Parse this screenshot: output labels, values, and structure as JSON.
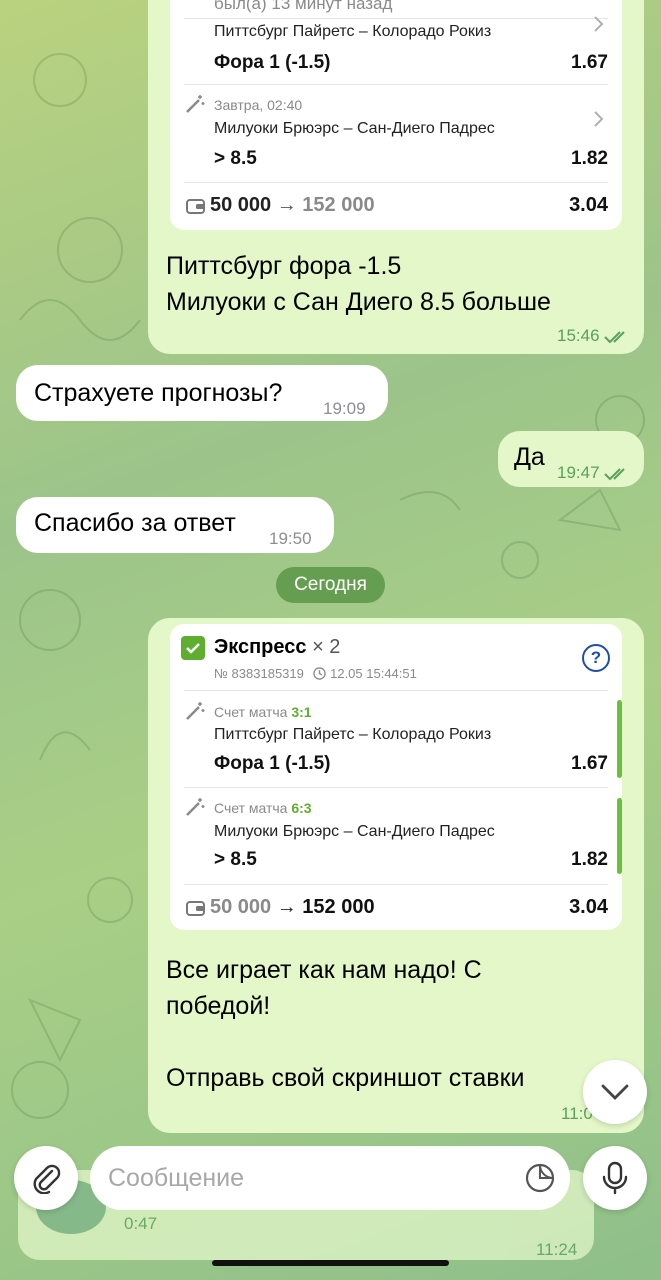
{
  "colors": {
    "incoming_bubble": "#ffffff",
    "outgoing_bubble": "#e3f7c9",
    "accent_green": "#6cbf3c",
    "date_pill": "#5a9646"
  },
  "top_card": {
    "partial_header": "был(а) 13 минут назад",
    "legs": [
      {
        "teams": "Питтсбург Пайретс – Колорадо Рокиз",
        "market": "Фора 1 (-1.5)",
        "odds": "1.67"
      },
      {
        "time": "Завтра, 02:40",
        "teams": "Милуоки Брюэрс – Сан-Диего Падрес",
        "market": "> 8.5",
        "odds": "1.82"
      }
    ],
    "stake": "50 000",
    "payout": "152 000",
    "total_odds": "3.04"
  },
  "messages": [
    {
      "direction": "out",
      "lines": [
        "Питтсбург фора -1.5",
        "Милуоки с Сан Диего 8.5 больше"
      ],
      "time": "15:46"
    },
    {
      "direction": "in",
      "text": "Страхуете прогнозы?",
      "time": "19:09"
    },
    {
      "direction": "out",
      "text": "Да",
      "time": "19:47"
    },
    {
      "direction": "in",
      "text": "Спасибо за ответ",
      "time": "19:50"
    }
  ],
  "date_separator": "Сегодня",
  "express_card": {
    "title": "Экспресс",
    "multiplier": "× 2",
    "number": "№ 8383185319",
    "datetime": "12.05 15:44:51",
    "legs": [
      {
        "score_label": "Счет матча",
        "score": "3:1",
        "teams": "Питтсбург Пайретс – Колорадо Рокиз",
        "market": "Фора 1 (-1.5)",
        "odds": "1.67"
      },
      {
        "score_label": "Счет матча",
        "score": "6:3",
        "teams": "Милуоки Брюэрс – Сан-Диего Падрес",
        "market": "> 8.5",
        "odds": "1.82"
      }
    ],
    "stake": "50 000",
    "payout": "152 000",
    "total_odds": "3.04"
  },
  "last_message": {
    "lines": [
      "Все играет как нам надо! С",
      "победой!",
      "",
      "Отправь свой скриншот ставки"
    ],
    "time_partial": "11:0"
  },
  "behind_input": {
    "duration": "0:47",
    "time": "11:24"
  },
  "composer": {
    "placeholder": "Сообщение"
  },
  "icons": {
    "attach": "paperclip-icon",
    "sticker": "sticker-icon",
    "mic": "microphone-icon",
    "scroll_down": "chevron-down-icon",
    "wallet": "wallet-icon",
    "clock": "clock-icon",
    "help": "question-icon",
    "wand": "magic-wand-icon"
  }
}
